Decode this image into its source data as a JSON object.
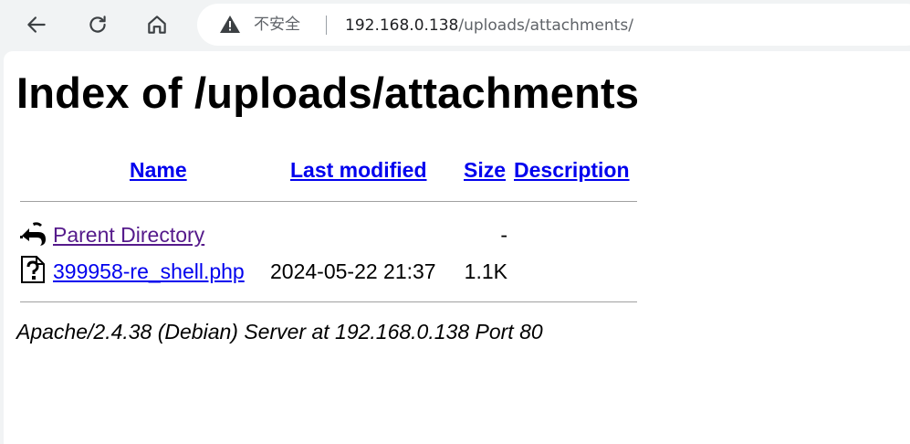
{
  "browser": {
    "security_label": "不安全",
    "url_host": "192.168.0.138",
    "url_path": "/uploads/attachments/"
  },
  "page": {
    "title": "Index of /uploads/attachments",
    "columns": {
      "name": "Name",
      "last_modified": "Last modified",
      "size": "Size",
      "description": "Description"
    },
    "entries": [
      {
        "icon": "back-icon",
        "name": "Parent Directory",
        "last_modified": "",
        "size": "-",
        "description": ""
      },
      {
        "icon": "unknown-file-icon",
        "name": "399958-re_shell.php",
        "last_modified": "2024-05-22 21:37",
        "size": "1.1K",
        "description": ""
      }
    ],
    "footer": "Apache/2.4.38 (Debian) Server at 192.168.0.138 Port 80"
  },
  "colors": {
    "link": "#0000ee",
    "visited_link": "#551a8b",
    "chrome_bg": "#f1f3f4"
  }
}
